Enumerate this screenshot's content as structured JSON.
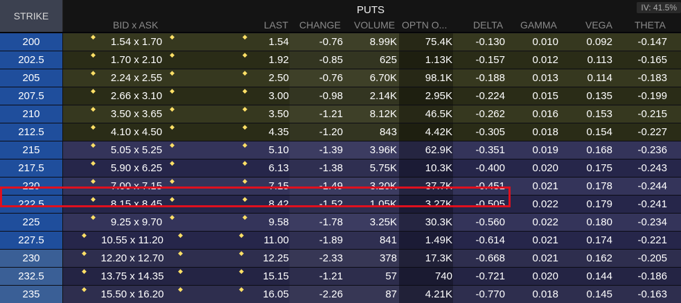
{
  "header": {
    "strike_label": "STRIKE",
    "puts_label": "PUTS",
    "iv_label": "IV: 41.5%",
    "columns": {
      "bid_ask": "BID x ASK",
      "last": "LAST",
      "change": "CHANGE",
      "volume": "VOLUME",
      "optn_open_int": "OPTN O...",
      "delta": "DELTA",
      "gamma": "GAMMA",
      "vega": "VEGA",
      "theta": "THETA"
    }
  },
  "rows": [
    {
      "strike": "200",
      "bid_ask": "1.54 x 1.70",
      "last": "1.54",
      "change": "-0.76",
      "volume": "8.99K",
      "open_int": "75.4K",
      "delta": "-0.130",
      "gamma": "0.010",
      "vega": "0.092",
      "theta": "-0.147"
    },
    {
      "strike": "202.5",
      "bid_ask": "1.70 x 2.10",
      "last": "1.92",
      "change": "-0.85",
      "volume": "625",
      "open_int": "1.13K",
      "delta": "-0.157",
      "gamma": "0.012",
      "vega": "0.113",
      "theta": "-0.165"
    },
    {
      "strike": "205",
      "bid_ask": "2.24 x 2.55",
      "last": "2.50",
      "change": "-0.76",
      "volume": "6.70K",
      "open_int": "98.1K",
      "delta": "-0.188",
      "gamma": "0.013",
      "vega": "0.114",
      "theta": "-0.183"
    },
    {
      "strike": "207.5",
      "bid_ask": "2.66 x 3.10",
      "last": "3.00",
      "change": "-0.98",
      "volume": "2.14K",
      "open_int": "2.95K",
      "delta": "-0.224",
      "gamma": "0.015",
      "vega": "0.135",
      "theta": "-0.199"
    },
    {
      "strike": "210",
      "bid_ask": "3.50 x 3.65",
      "last": "3.50",
      "change": "-1.21",
      "volume": "8.12K",
      "open_int": "46.5K",
      "delta": "-0.262",
      "gamma": "0.016",
      "vega": "0.153",
      "theta": "-0.215"
    },
    {
      "strike": "212.5",
      "bid_ask": "4.10 x 4.50",
      "last": "4.35",
      "change": "-1.20",
      "volume": "843",
      "open_int": "4.42K",
      "delta": "-0.305",
      "gamma": "0.018",
      "vega": "0.154",
      "theta": "-0.227"
    },
    {
      "strike": "215",
      "bid_ask": "5.05 x 5.25",
      "last": "5.10",
      "change": "-1.39",
      "volume": "3.96K",
      "open_int": "62.9K",
      "delta": "-0.351",
      "gamma": "0.019",
      "vega": "0.168",
      "theta": "-0.236"
    },
    {
      "strike": "217.5",
      "bid_ask": "5.90 x 6.25",
      "last": "6.13",
      "change": "-1.38",
      "volume": "5.75K",
      "open_int": "10.3K",
      "delta": "-0.400",
      "gamma": "0.020",
      "vega": "0.175",
      "theta": "-0.243"
    },
    {
      "strike": "220",
      "bid_ask": "7.00 x 7.15",
      "last": "7.15",
      "change": "-1.49",
      "volume": "3.20K",
      "open_int": "37.7K",
      "delta": "-0.451",
      "gamma": "0.021",
      "vega": "0.178",
      "theta": "-0.244"
    },
    {
      "strike": "222.5",
      "bid_ask": "8.15 x 8.45",
      "last": "8.42",
      "change": "-1.52",
      "volume": "1.05K",
      "open_int": "3.27K",
      "delta": "-0.505",
      "gamma": "0.022",
      "vega": "0.179",
      "theta": "-0.241"
    },
    {
      "strike": "225",
      "bid_ask": "9.25 x 9.70",
      "last": "9.58",
      "change": "-1.78",
      "volume": "3.25K",
      "open_int": "30.3K",
      "delta": "-0.560",
      "gamma": "0.022",
      "vega": "0.180",
      "theta": "-0.234"
    },
    {
      "strike": "227.5",
      "bid_ask": "10.55 x 11.20",
      "last": "11.00",
      "change": "-1.89",
      "volume": "841",
      "open_int": "1.49K",
      "delta": "-0.614",
      "gamma": "0.021",
      "vega": "0.174",
      "theta": "-0.221"
    },
    {
      "strike": "230",
      "bid_ask": "12.20 x 12.70",
      "last": "12.25",
      "change": "-2.33",
      "volume": "378",
      "open_int": "17.3K",
      "delta": "-0.668",
      "gamma": "0.021",
      "vega": "0.162",
      "theta": "-0.205"
    },
    {
      "strike": "232.5",
      "bid_ask": "13.75 x 14.35",
      "last": "15.15",
      "change": "-1.21",
      "volume": "57",
      "open_int": "740",
      "delta": "-0.721",
      "gamma": "0.020",
      "vega": "0.144",
      "theta": "-0.186"
    },
    {
      "strike": "235",
      "bid_ask": "15.50 x 16.20",
      "last": "16.05",
      "change": "-2.26",
      "volume": "87",
      "open_int": "4.21K",
      "delta": "-0.770",
      "gamma": "0.018",
      "vega": "0.145",
      "theta": "-0.163"
    }
  ],
  "colors": {
    "itm_row_a": "#36381f",
    "itm_row_b": "#2a2c17",
    "otm_row_a": "#34345a",
    "otm_row_b": "#26264a",
    "deep_row_a": "#2e2e4e",
    "deep_row_b": "#242444",
    "strike_blue": "#1f4e9c",
    "strike_light": "#3a5f96",
    "highlight": "#e0101e",
    "dot": "#ffe066"
  }
}
